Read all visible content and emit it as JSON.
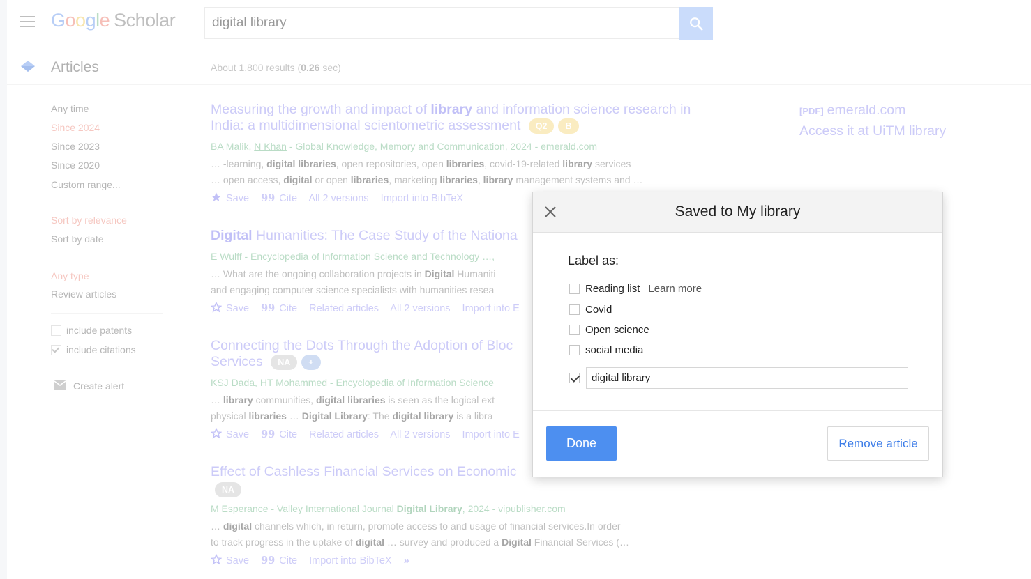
{
  "header": {
    "logo_google": [
      "G",
      "o",
      "o",
      "g",
      "l",
      "e"
    ],
    "logo_scholar": "Scholar",
    "search_value": "digital library"
  },
  "subheader": {
    "section": "Articles",
    "stats_prefix": "About 1,800 results (",
    "stats_time": "0.26",
    "stats_suffix": " sec)"
  },
  "sidebar": {
    "time": [
      "Any time",
      "Since 2024",
      "Since 2023",
      "Since 2020",
      "Custom range..."
    ],
    "sort": [
      "Sort by relevance",
      "Sort by date"
    ],
    "type": [
      "Any type",
      "Review articles"
    ],
    "include_patents": "include patents",
    "include_citations": "include citations",
    "create_alert": "Create alert"
  },
  "results": [
    {
      "title_a": "Measuring the growth and impact of ",
      "title_b": "library",
      "title_c": " and information science research in",
      "title_d": "India: a multidimensional scientometric assessment",
      "badges": [
        "Q2",
        "B"
      ],
      "meta_a": "BA Malik, ",
      "meta_b": "N Khan",
      "meta_c": " - Global Knowledge, Memory and Communication, 2024 - emerald.com",
      "snip1": [
        "… -learning, ",
        "digital libraries",
        ", open repositories, open ",
        "libraries",
        ", covid-19-related ",
        "library",
        " services"
      ],
      "snip2": [
        "… open access, ",
        "digital",
        " or open ",
        "libraries",
        ", marketing ",
        "libraries",
        ", ",
        "library",
        " management systems and …"
      ],
      "actions": [
        "Save",
        "Cite",
        "All 2 versions",
        "Import into BibTeX"
      ]
    },
    {
      "title_a": "Digital",
      "title_b": " Humanities: The Case Study of the Nationa",
      "meta": "E Wulff - Encyclopedia of Information Science and Technology …,",
      "snip1": [
        "… What are the ongoing collaboration projects in ",
        "Digital",
        " Humaniti"
      ],
      "snip2": "and engaging computer science specialists with humanities resea",
      "actions": [
        "Save",
        "Cite",
        "Related articles",
        "All 2 versions",
        "Import into E"
      ]
    },
    {
      "title_a": "Connecting the Dots Through the Adoption of Bloc",
      "title_b": "Services",
      "badges": [
        "NA",
        "+"
      ],
      "meta_a": "KSJ Dada",
      "meta_b": ", HT Mohammed - Encyclopedia of Information Science",
      "snip1": [
        "… ",
        "library",
        " communities, ",
        "digital libraries",
        " is seen as the logical ext"
      ],
      "snip2": [
        "physical ",
        "libraries",
        " … ",
        "Digital Library",
        ": The ",
        "digital library",
        " is a libra"
      ],
      "actions": [
        "Save",
        "Cite",
        "Related articles",
        "All 2 versions",
        "Import into E"
      ]
    },
    {
      "title_a": "Effect of Cashless Financial Services on Economic",
      "badges": [
        "NA"
      ],
      "meta_a": "M Esperance - Valley International Journal ",
      "meta_b": "Digital Library",
      "meta_c": ", 2024 - vipublisher.com",
      "snip1": [
        "… ",
        "digital",
        " channels which, in return, promote access to and usage of financial services.In order"
      ],
      "snip2": [
        "to track progress in the uptake of ",
        "digital",
        " … survey and produced a ",
        "Digital",
        " Financial Services (…"
      ],
      "actions": [
        "Save",
        "Cite",
        "Import into BibTeX"
      ]
    }
  ],
  "right_col": {
    "pdf_tag": "[PDF]",
    "pdf_source": "emerald.com",
    "access": "Access it at UiTM library"
  },
  "modal": {
    "title": "Saved to My library",
    "label_as": "Label as:",
    "options": [
      "Reading list",
      "Covid",
      "Open science",
      "social media"
    ],
    "learn_more": "Learn more",
    "new_label_value": "digital library",
    "done": "Done",
    "remove": "Remove article"
  },
  "colors": {
    "link": "#a3a0f2",
    "meta_green": "#82c097",
    "sidebar_active": "#ee9a8e",
    "done_blue": "#4d8ff0",
    "search_blue": "#9ec0f7"
  }
}
